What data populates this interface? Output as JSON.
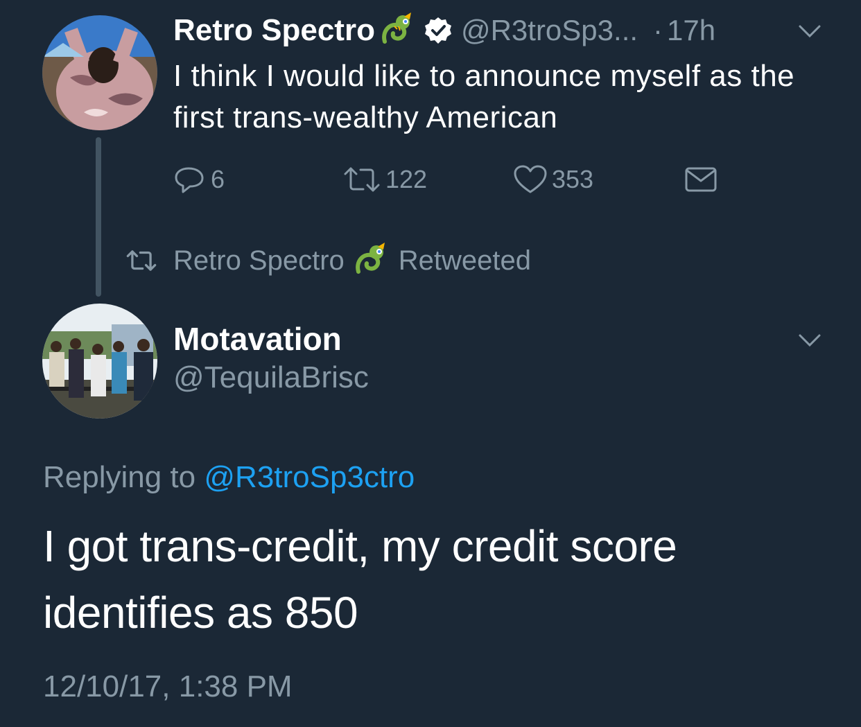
{
  "colors": {
    "background": "#1b2836",
    "text_primary": "#ffffff",
    "text_secondary": "#8899a6",
    "link": "#1da1f2",
    "thread_line": "#425462"
  },
  "retweeted_tweet": {
    "author_name": "Retro Spectro",
    "author_emoji_icon": "dragon-icon",
    "verified_icon": "verified-badge-icon",
    "handle": "@R3troSp3...",
    "separator": "·",
    "time": "17h",
    "text": "I think I would like to announce myself as the first trans-wealthy American",
    "actions": {
      "reply_count": "6",
      "retweet_count": "122",
      "like_count": "353"
    }
  },
  "retweet_indicator": {
    "name": "Retro Spectro",
    "label": "Retweeted"
  },
  "reply_tweet": {
    "author_name": "Motavation",
    "handle": "@TequilaBrisc",
    "replying_prefix": "Replying to",
    "replying_to": "@R3troSp3ctro",
    "text": "I got trans-credit, my credit score identifies as 850",
    "timestamp": "12/10/17, 1:38 PM"
  }
}
